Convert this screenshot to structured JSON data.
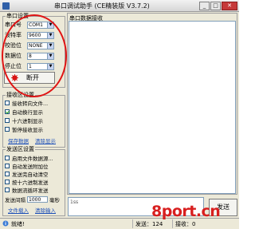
{
  "title": "串口调试助手 (CE精装版 V3.7.2)",
  "serial_settings": {
    "group_title": "串口设置",
    "port_label": "串口号",
    "port_value": "COM1",
    "baud_label": "波特率",
    "baud_value": "9600",
    "parity_label": "校验位",
    "parity_value": "NONE",
    "databits_label": "数据位",
    "databits_value": "8",
    "stopbits_label": "停止位",
    "stopbits_value": "1",
    "open_button": "断开"
  },
  "receive_settings": {
    "group_title": "接收区设置",
    "options": [
      {
        "label": "接收转向文件...",
        "checked": false
      },
      {
        "label": "自动换行显示",
        "checked": true
      },
      {
        "label": "十六进制显示",
        "checked": false
      },
      {
        "label": "暂停接收显示",
        "checked": false
      }
    ],
    "save_link": "保存数据",
    "clear_link": "清除显示"
  },
  "send_settings": {
    "group_title": "发送区设置",
    "options": [
      {
        "label": "启用文件数据源...",
        "checked": false
      },
      {
        "label": "自动发送附加位",
        "checked": false
      },
      {
        "label": "发送完自动清空",
        "checked": false
      },
      {
        "label": "按十六进制发送",
        "checked": false
      },
      {
        "label": "数据流循环发送",
        "checked": false
      }
    ],
    "interval_label": "发送间隔",
    "interval_value": "1000",
    "interval_unit": "毫秒",
    "file_link": "文件载入",
    "clear_input_link": "清除输入"
  },
  "receive_area": {
    "title": "串口数据接收"
  },
  "send_area": {
    "content": "1ss",
    "send_button": "发送"
  },
  "status_bar": {
    "status": "就绪!",
    "send_count": "发送：124",
    "recv_count": "接收：0"
  },
  "watermark": "8port.cn",
  "colors": {
    "annotation": "#e01414",
    "watermark": "#d81f1f",
    "link": "#1d4fb8"
  }
}
